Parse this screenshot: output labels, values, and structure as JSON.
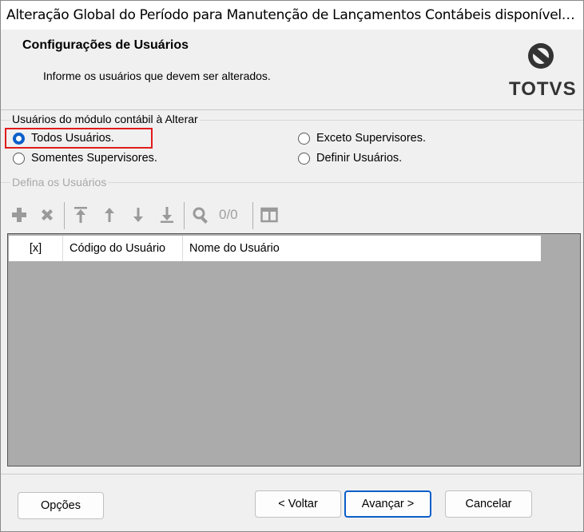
{
  "window": {
    "title": "Alteração Global do Período para Manutenção de Lançamentos Contábeis disponível no..."
  },
  "header": {
    "title": "Configurações de Usuários",
    "subtitle": "Informe os usuários que devem ser alterados.",
    "logo_text": "TOTVS"
  },
  "user_group": {
    "label": "Usuários do módulo contábil à Alterar",
    "options": [
      {
        "label": "Todos Usuários.",
        "checked": true
      },
      {
        "label": "Exceto Supervisores.",
        "checked": false
      },
      {
        "label": "Somentes Supervisores.",
        "checked": false
      },
      {
        "label": "Definir Usuários.",
        "checked": false
      }
    ]
  },
  "define_group": {
    "label": "Defina os Usuários",
    "toolbar": {
      "icons": [
        "add-icon",
        "delete-icon",
        "move-top-icon",
        "move-up-icon",
        "move-down-icon",
        "move-bottom-icon",
        "search-icon",
        "columns-icon"
      ],
      "record_count": "0/0"
    },
    "grid": {
      "columns": [
        "[x]",
        "Código do Usuário",
        "Nome do Usuário"
      ],
      "rows": []
    }
  },
  "footer": {
    "options_label": "Opções",
    "back_label": "< Voltar",
    "next_label": "Avançar >",
    "cancel_label": "Cancelar"
  },
  "colors": {
    "accent": "#0b5fc9",
    "highlight": "#e11b1b",
    "grid_bg": "#ababab"
  }
}
